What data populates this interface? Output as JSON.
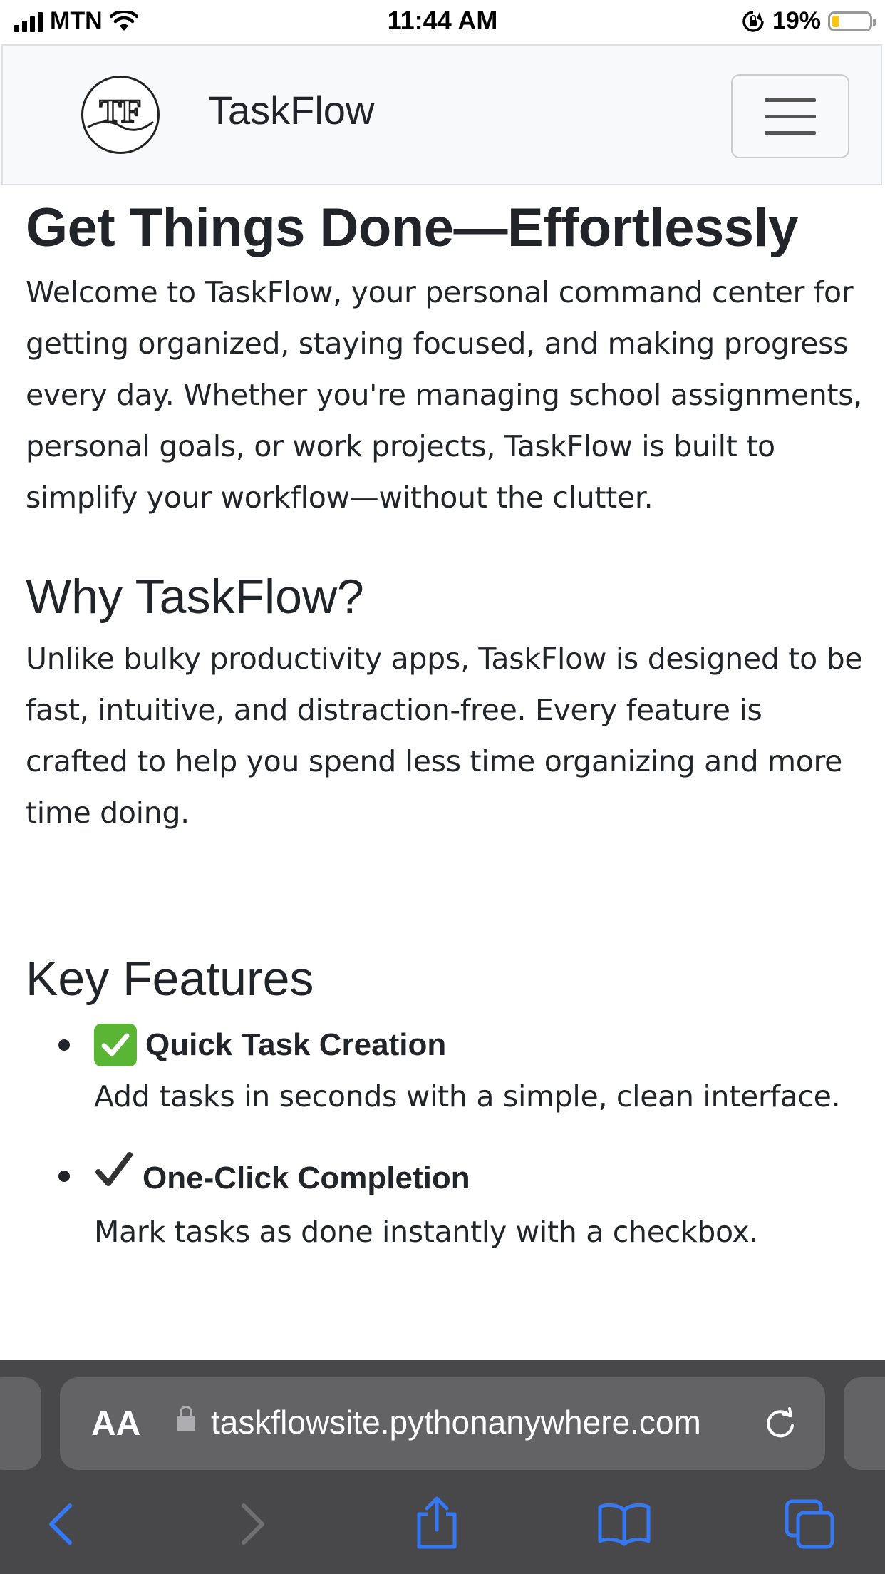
{
  "status_bar": {
    "carrier": "MTN",
    "time": "11:44 AM",
    "battery": "19%",
    "battery_level": 0.19
  },
  "navbar": {
    "logo_text": "TF",
    "brand": "TaskFlow",
    "menu_icon": "hamburger-icon"
  },
  "hero": {
    "title": "Get Things Done—Effortlessly",
    "intro": "Welcome to TaskFlow, your personal command center for getting organized, staying focused, and making progress every day. Whether you're managing school assignments, personal goals, or work projects, TaskFlow is built to simplify your workflow—without the clutter."
  },
  "why": {
    "heading": "Why TaskFlow?",
    "text": "Unlike bulky productivity apps, TaskFlow is designed to be fast, intuitive, and distraction-free. Every feature is crafted to help you spend less time organizing and more time doing."
  },
  "features": {
    "heading": "Key Features",
    "items": [
      {
        "icon": "check-mark-button-icon",
        "title": "Quick Task Creation",
        "desc": "Add tasks in seconds with a simple, clean interface."
      },
      {
        "icon": "check-mark-icon",
        "title": "One-Click Completion",
        "desc": "Mark tasks as done instantly with a checkbox."
      }
    ]
  },
  "browser": {
    "aa_label": "AA",
    "url": "taskflowsite.pythonanywhere.com",
    "accent": "#3478f6"
  }
}
